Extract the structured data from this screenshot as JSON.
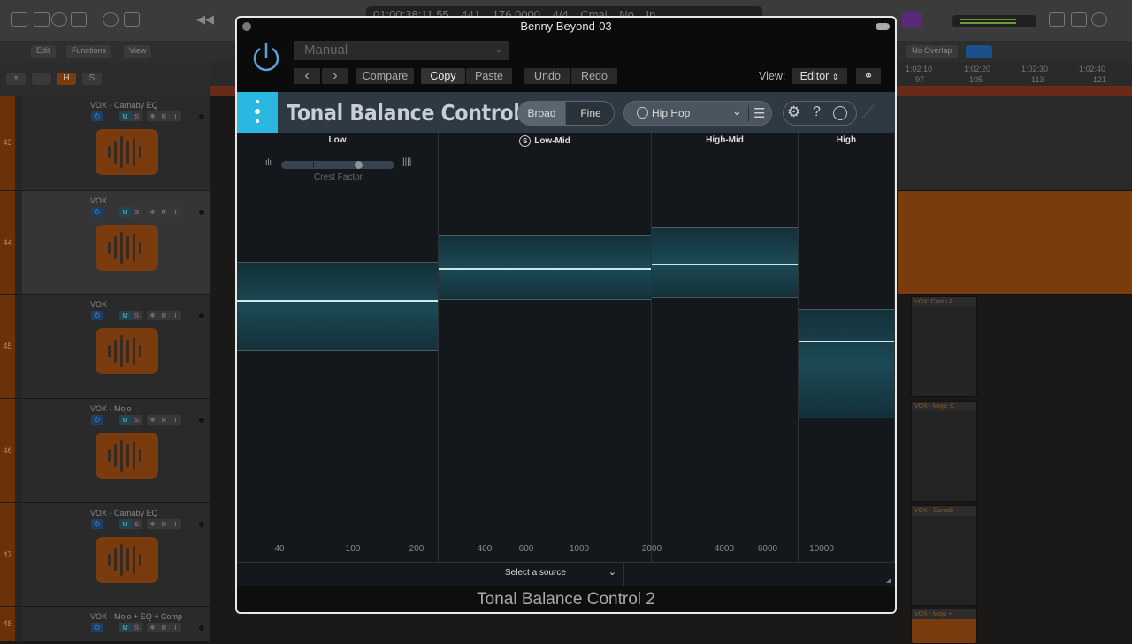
{
  "logic": {
    "lcd": {
      "position": "01:00:38:11.55",
      "bar": "441",
      "tempo": "176.0000",
      "signature": "4/4",
      "key": "Cmaj",
      "input": "No In"
    },
    "toolbar": {
      "edit": "Edit",
      "functions": "Functions",
      "view": "View",
      "drag_mode": "No Overlap"
    },
    "header_buttons": {
      "add": "+",
      "hide": "H",
      "solo": "S"
    },
    "ruler": {
      "times": [
        "1:02:10",
        "1:02:20",
        "1:02:30",
        "1:02:40"
      ],
      "bars": [
        "97",
        "105",
        "113",
        "121"
      ]
    },
    "tracks": [
      {
        "number": "43",
        "name": "VOX - Carnaby EQ"
      },
      {
        "number": "44",
        "name": "VOX"
      },
      {
        "number": "45",
        "name": "VOX"
      },
      {
        "number": "46",
        "name": "VOX - Mojo"
      },
      {
        "number": "47",
        "name": "VOX - Carnaby EQ"
      },
      {
        "number": "48",
        "name": "VOX - Mojo + EQ + Comp"
      }
    ],
    "track_buttons": {
      "mute": "M",
      "solo": "S",
      "freeze": "❄",
      "record": "R",
      "input": "I"
    },
    "regions": [
      "VOX: Comp A",
      "VOX - Mojo: C",
      "VOX - Carnab",
      "VOX - Mojo +"
    ]
  },
  "plugin": {
    "window_title": "Benny Beyond-03",
    "preset": "Manual",
    "buttons": {
      "prev": "‹",
      "next": "›",
      "compare": "Compare",
      "copy": "Copy",
      "paste": "Paste",
      "undo": "Undo",
      "redo": "Redo"
    },
    "view_label": "View:",
    "view_value": "Editor",
    "product_title": "Tonal Balance Control",
    "mode_tabs": [
      {
        "label": "Broad",
        "active": true
      },
      {
        "label": "Fine",
        "active": false
      }
    ],
    "target": "Hip Hop",
    "crest_factor_label": "Crest Factor",
    "crest_factor_value": 0.68,
    "bands": [
      {
        "label": "Low",
        "range_top": 0.3,
        "range_bottom": 0.51,
        "value": 0.39
      },
      {
        "label": "Low-Mid",
        "range_top": 0.24,
        "range_bottom": 0.39,
        "value": 0.315,
        "solo": "S"
      },
      {
        "label": "High-Mid",
        "range_top": 0.22,
        "range_bottom": 0.385,
        "value": 0.305
      },
      {
        "label": "High",
        "range_top": 0.41,
        "range_bottom": 0.665,
        "value": 0.485
      }
    ],
    "freq_labels": [
      "40",
      "100",
      "200",
      "400",
      "600",
      "1000",
      "2000",
      "4000",
      "6000",
      "10000"
    ],
    "source_select": "Select a source",
    "footer": "Tonal Balance Control 2",
    "accent": "#2ab8e2"
  }
}
